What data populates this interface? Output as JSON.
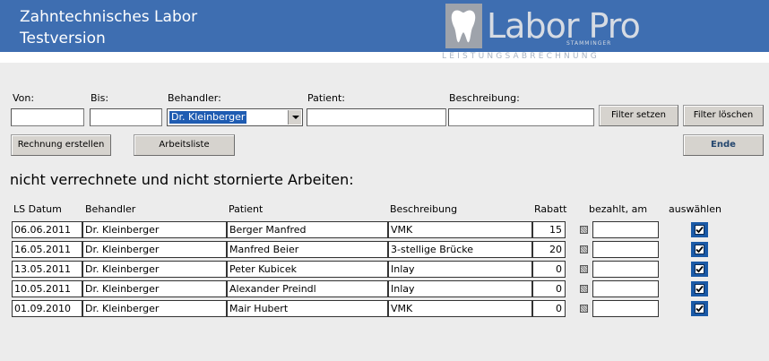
{
  "header": {
    "title_line1": "Zahntechnisches Labor",
    "title_line2": "Testversion",
    "logo_word": "Labor Pro",
    "logo_sub": "STAMMINGER",
    "logo_tagline": "LEISTUNGSABRECHNUNG"
  },
  "filters": {
    "von_label": "Von:",
    "bis_label": "Bis:",
    "behandler_label": "Behandler:",
    "patient_label": "Patient:",
    "beschreibung_label": "Beschreibung:",
    "von_value": "",
    "bis_value": "",
    "behandler_value": "Dr. Kleinberger",
    "patient_value": "",
    "beschreibung_value": ""
  },
  "buttons": {
    "filter_setzen": "Filter setzen",
    "filter_loeschen": "Filter löschen",
    "rechnung_erstellen": "Rechnung erstellen",
    "arbeitsliste": "Arbeitsliste",
    "ende": "Ende"
  },
  "section_title": "nicht verrechnete und nicht stornierte Arbeiten:",
  "table": {
    "headers": {
      "datum": "LS Datum",
      "behandler": "Behandler",
      "patient": "Patient",
      "beschreibung": "Beschreibung",
      "rabatt": "Rabatt",
      "bezahlt": "bezahlt, am",
      "auswaehlen": "auswählen"
    },
    "rows": [
      {
        "datum": "06.06.2011",
        "behandler": "Dr. Kleinberger",
        "patient": "Berger Manfred",
        "beschreibung": "VMK",
        "rabatt": "15",
        "bezahlt_am": "",
        "ausgewaehlt": true
      },
      {
        "datum": "16.05.2011",
        "behandler": "Dr. Kleinberger",
        "patient": "Manfred Beier",
        "beschreibung": "3-stellige Brücke",
        "rabatt": "20",
        "bezahlt_am": "",
        "ausgewaehlt": true
      },
      {
        "datum": "13.05.2011",
        "behandler": "Dr. Kleinberger",
        "patient": "Peter Kubicek",
        "beschreibung": "Inlay",
        "rabatt": "0",
        "bezahlt_am": "",
        "ausgewaehlt": true
      },
      {
        "datum": "10.05.2011",
        "behandler": "Dr. Kleinberger",
        "patient": "Alexander Preindl",
        "beschreibung": "Inlay",
        "rabatt": "0",
        "bezahlt_am": "",
        "ausgewaehlt": true
      },
      {
        "datum": "01.09.2010",
        "behandler": "Dr. Kleinberger",
        "patient": "Mair Hubert",
        "beschreibung": "VMK",
        "rabatt": "0",
        "bezahlt_am": "",
        "ausgewaehlt": true
      }
    ]
  },
  "colors": {
    "header_bg": "#3e6eb1",
    "checkbox_bg": "#1a59a6",
    "selection_bg": "#1f5cb2"
  }
}
